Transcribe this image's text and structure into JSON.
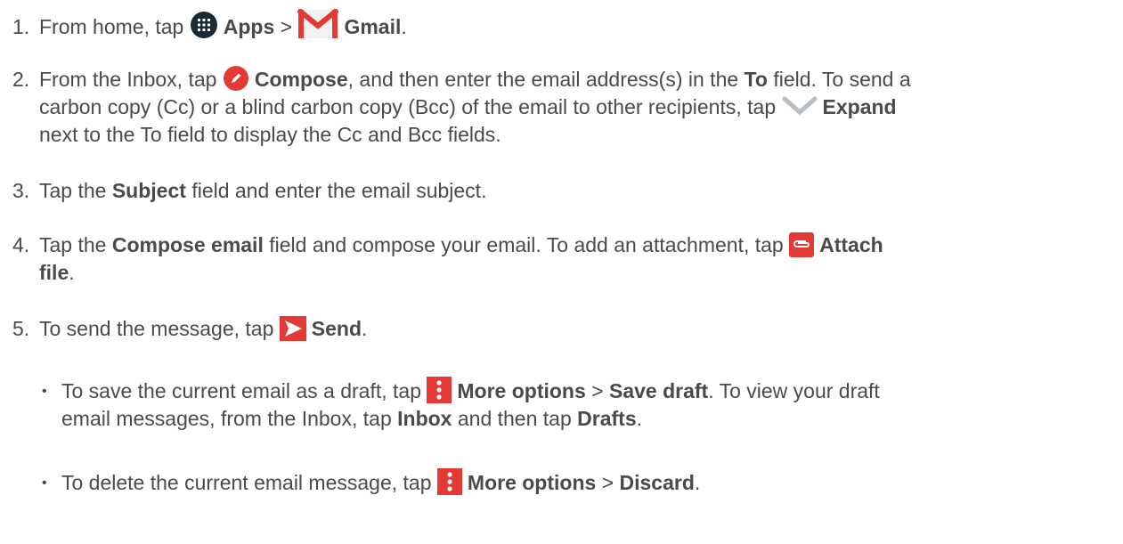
{
  "steps": [
    {
      "num": "1.",
      "t1": "From home, tap",
      "b1": "Apps",
      "t2": ">",
      "b2": "Gmail",
      "t3": "."
    },
    {
      "num": "2.",
      "t1": "From the Inbox, tap",
      "b1": "Compose",
      "t2": ", and then enter the email address(s) in the",
      "b2": "To",
      "t3": "field. To send a",
      "t4": "carbon copy (Cc) or a blind carbon copy (Bcc) of the email to other recipients, tap",
      "b3": "Expand",
      "t5": "next to the To field to display the Cc and Bcc fields."
    },
    {
      "num": "3.",
      "t1": "Tap the",
      "b1": "Subject",
      "t2": "field and enter the email subject."
    },
    {
      "num": "4.",
      "t1": "Tap the",
      "b1": "Compose email",
      "t2": "field and compose your email. To add an attachment, tap",
      "b2": "Attach",
      "b3": "file",
      "t3": "."
    },
    {
      "num": "5.",
      "t1": "To send the message, tap",
      "b1": "Send",
      "t2": "."
    }
  ],
  "bullets": [
    {
      "mark": "•",
      "t1": "To save the current email as a draft, tap",
      "b1": "More options",
      "t2": ">",
      "b2": "Save draft",
      "t3": ". To view your draft",
      "t4": "email messages, from the Inbox, tap",
      "b3": "Inbox",
      "t5": "and then tap",
      "b4": "Drafts",
      "t6": "."
    },
    {
      "mark": "•",
      "t1": "To delete the current email message, tap",
      "b1": "More options",
      "t2": ">",
      "b2": "Discard",
      "t3": "."
    }
  ],
  "icons": {
    "apps": "apps-grid-icon",
    "gmail": "gmail-icon",
    "compose": "compose-pencil-icon",
    "expand": "chevron-down-icon",
    "attach": "paperclip-icon",
    "send": "send-arrow-icon",
    "more": "more-options-icon"
  },
  "colors": {
    "text": "#4a4a4a",
    "gmail_red": "#e53935",
    "icon_dark": "#1c2a36",
    "chevron_gray": "#b8bec4"
  }
}
